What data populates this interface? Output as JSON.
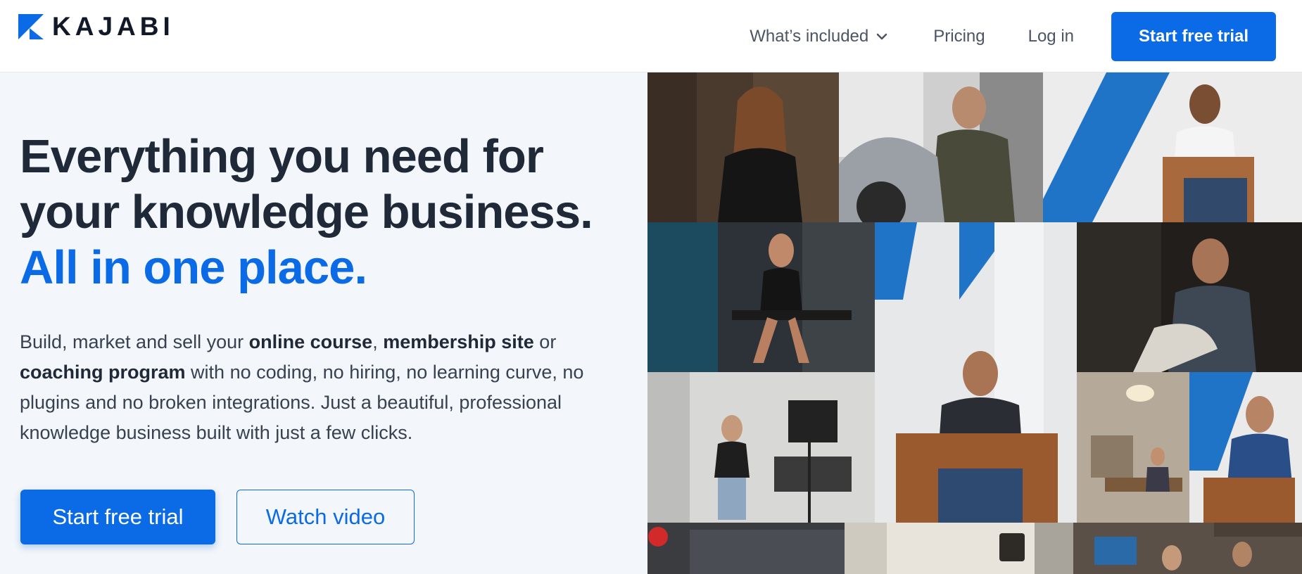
{
  "brand": {
    "name": "KAJABI",
    "logo_icon": "kajabi-k-logo",
    "accent": "#0b6be6"
  },
  "nav": {
    "included_label": "What’s included",
    "included_icon": "chevron-down-icon",
    "pricing_label": "Pricing",
    "login_label": "Log in",
    "cta_label": "Start free trial"
  },
  "hero": {
    "headline_line1": "Everything you need for",
    "headline_line2": "your knowledge business.",
    "headline_accent": "All in one place.",
    "desc": {
      "p1": "Build, market and sell your ",
      "b1": "online course",
      "p2": ", ",
      "b2": "membership site",
      "p3": " or ",
      "b3": "coaching program",
      "p4": " with no coding, no hiring, no learning curve, no plugins and no broken integrations. Just a beautiful, professional knowledge business built with just a few clicks."
    },
    "primary_cta": "Start free trial",
    "secondary_cta": "Watch video"
  },
  "collage": {
    "photos": [
      "woman-in-kajabihero-tshirt",
      "man-on-motorcycle",
      "man-seated-in-chair-white-shirt",
      "woman-seated-on-gym-bench",
      "kajabi-logo-wall-pillar",
      "bearded-man-in-dark-room",
      "woman-presenting-in-studio",
      "man-with-glasses-in-leather-chair",
      "woman-at-desk-under-chandelier",
      "smiling-man-in-blue-shirt",
      "red-light-bokeh",
      "shop-interior-with-sign",
      "office-people-at-computers"
    ]
  }
}
